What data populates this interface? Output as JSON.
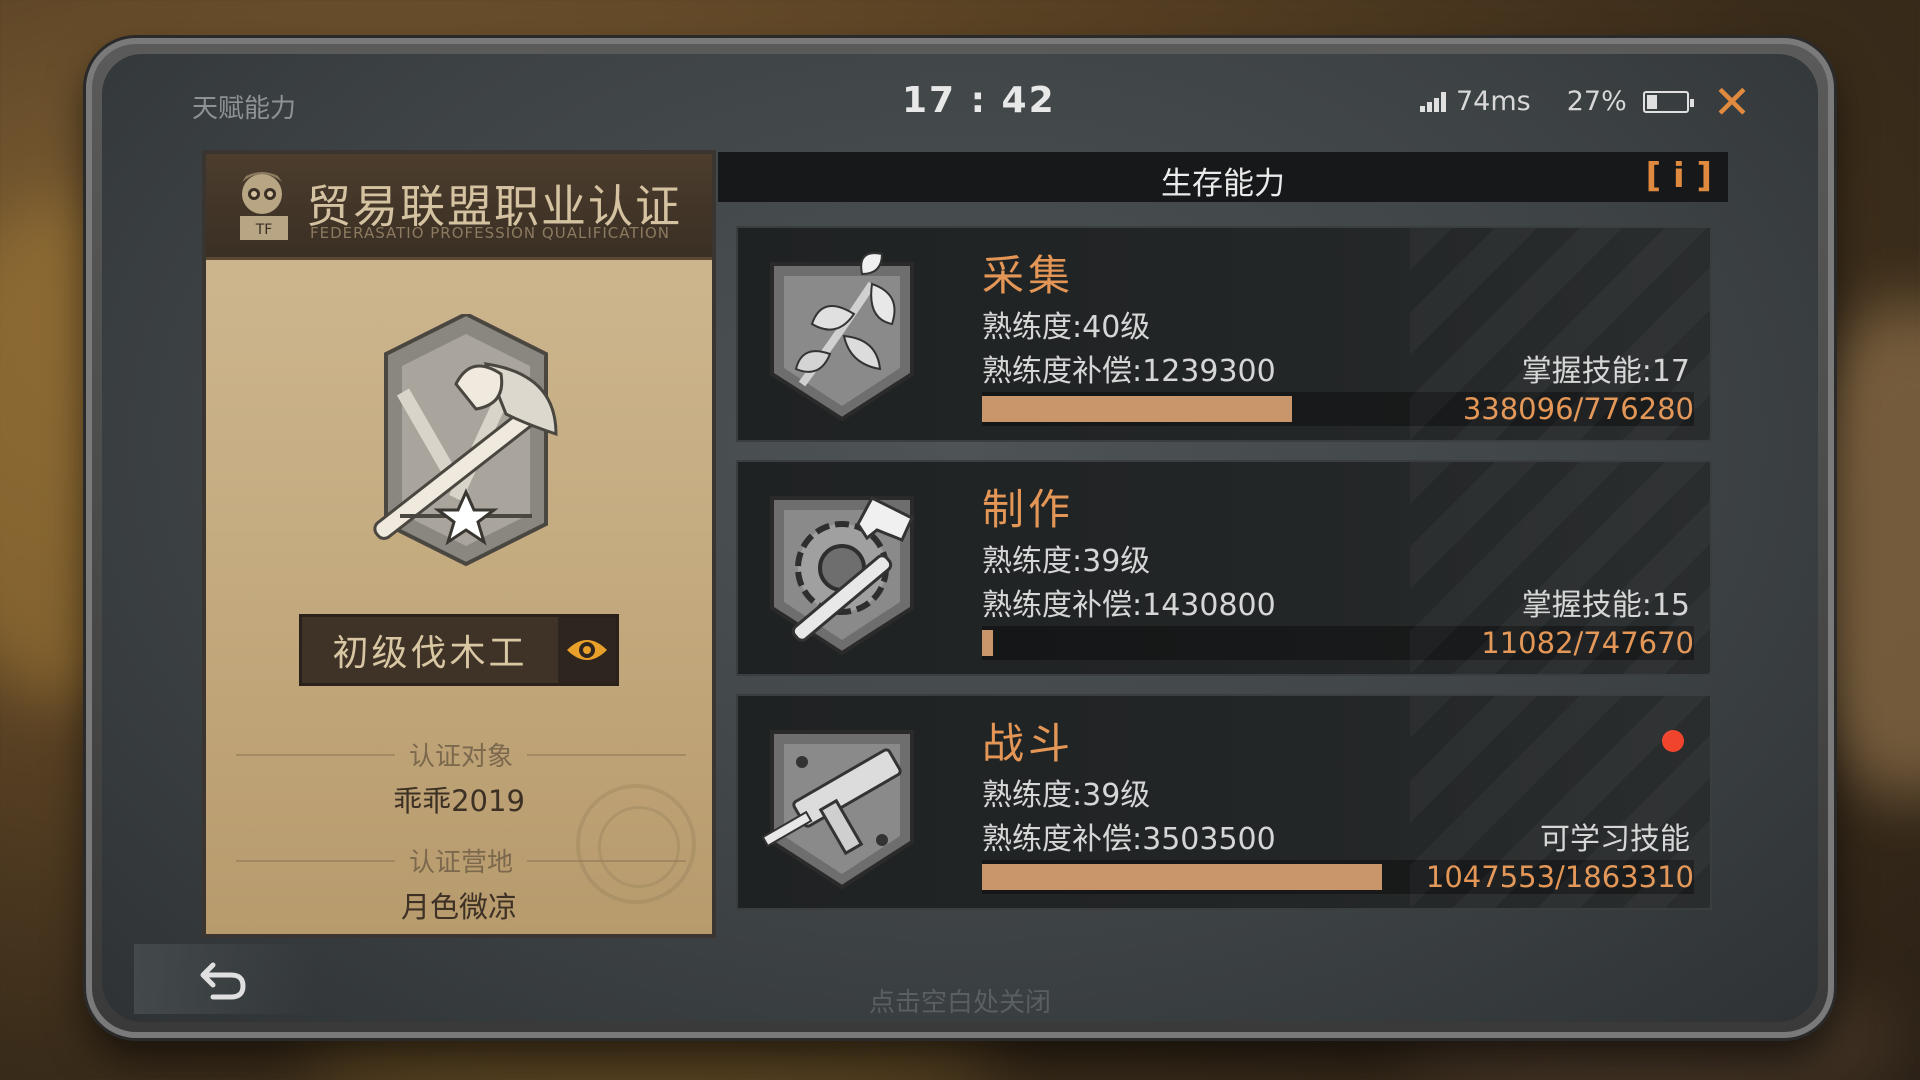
{
  "screen_title": "天赋能力",
  "status_bar": {
    "time": "17 : 42",
    "ping": "74ms",
    "battery_text": "27%",
    "battery_level": 0.27
  },
  "certificate": {
    "title": "贸易联盟职业认证",
    "subtitle": "FEDERASATIO PROFESSION QUALIFICATION",
    "role": "初级伐木工",
    "subject_label": "认证对象",
    "subject_value": "乖乖2019",
    "camp_label": "认证营地",
    "camp_value": "月色微凉",
    "badge_icon": "axe-badge-icon"
  },
  "panel": {
    "title": "生存能力",
    "info_button": "[ i ]"
  },
  "skills": [
    {
      "name": "采集",
      "icon": "leaf-shield-icon",
      "level": "熟练度:40级",
      "compensation": "熟练度补偿:1239300",
      "mastered": "掌握技能:17",
      "progress_text": "338096/776280",
      "progress": 0.4355,
      "has_alert": false
    },
    {
      "name": "制作",
      "icon": "hammer-gear-shield-icon",
      "level": "熟练度:39级",
      "compensation": "熟练度补偿:1430800",
      "mastered": "掌握技能:15",
      "progress_text": "11082/747670",
      "progress": 0.0148,
      "has_alert": false
    },
    {
      "name": "战斗",
      "icon": "gun-shield-icon",
      "level": "熟练度:39级",
      "compensation": "熟练度补偿:3503500",
      "mastered": "可学习技能",
      "progress_text": "1047553/1863310",
      "progress": 0.5622,
      "has_alert": true
    }
  ],
  "footer": {
    "hint": "点击空白处关闭",
    "back_icon": "undo-arrow-icon"
  },
  "colors": {
    "accent": "#e39655",
    "progress_fill": "#c9956a",
    "alert": "#f0442c",
    "close": "#e08a40"
  }
}
